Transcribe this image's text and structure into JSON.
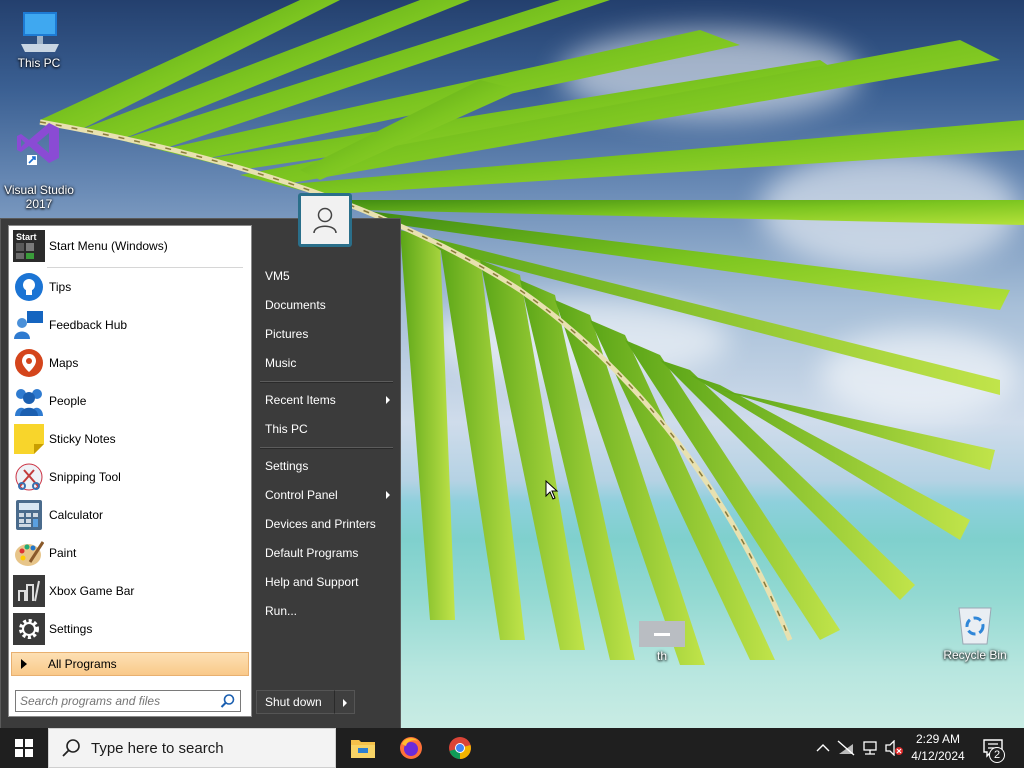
{
  "desktop": {
    "icons": [
      {
        "label": "This PC",
        "icon": "monitor-icon"
      },
      {
        "label": "Visual Studio\n2017",
        "icon": "visual-studio-icon"
      },
      {
        "label": "Recycle Bin",
        "icon": "recycle-bin-icon"
      },
      {
        "label": "th",
        "icon": "window-minimized-icon"
      }
    ]
  },
  "start_menu": {
    "pinned": {
      "label": "Start Menu (Windows)",
      "icon": "start-menu-icon",
      "badge": "Start"
    },
    "programs": [
      {
        "label": "Tips",
        "icon": "tips-icon"
      },
      {
        "label": "Feedback Hub",
        "icon": "feedback-hub-icon"
      },
      {
        "label": "Maps",
        "icon": "maps-icon"
      },
      {
        "label": "People",
        "icon": "people-icon"
      },
      {
        "label": "Sticky Notes",
        "icon": "sticky-notes-icon"
      },
      {
        "label": "Snipping Tool",
        "icon": "snipping-tool-icon"
      },
      {
        "label": "Calculator",
        "icon": "calculator-icon"
      },
      {
        "label": "Paint",
        "icon": "paint-icon"
      },
      {
        "label": "Xbox Game Bar",
        "icon": "xbox-game-bar-icon"
      },
      {
        "label": "Settings",
        "icon": "settings-gear-icon"
      }
    ],
    "all_programs": "All Programs",
    "search_placeholder": "Search programs and files",
    "right_items": [
      {
        "label": "VM5",
        "has_submenu": false
      },
      {
        "label": "Documents",
        "has_submenu": false
      },
      {
        "label": "Pictures",
        "has_submenu": false
      },
      {
        "label": "Music",
        "has_submenu": false
      },
      {
        "label": "Recent Items",
        "has_submenu": true
      },
      {
        "label": "This PC",
        "has_submenu": false
      },
      {
        "label": "Settings",
        "has_submenu": false
      },
      {
        "label": "Control Panel",
        "has_submenu": true
      },
      {
        "label": "Devices and Printers",
        "has_submenu": false
      },
      {
        "label": "Default Programs",
        "has_submenu": false
      },
      {
        "label": "Help and Support",
        "has_submenu": false
      },
      {
        "label": "Run...",
        "has_submenu": false
      }
    ],
    "shutdown": "Shut down"
  },
  "taskbar": {
    "search_placeholder": "Type here to search",
    "apps": [
      "file-explorer-icon",
      "firefox-icon",
      "chrome-icon"
    ],
    "tray": [
      "chevron-up-icon",
      "network-off-icon",
      "network-icon",
      "volume-muted-icon"
    ],
    "time": "2:29 AM",
    "date": "4/12/2024",
    "notification_count": "2"
  },
  "colors": {
    "start_menu_bg": "#3b3b3b",
    "all_programs_highlight": "#f9c98a",
    "taskbar_bg": "#1f1f1f"
  }
}
